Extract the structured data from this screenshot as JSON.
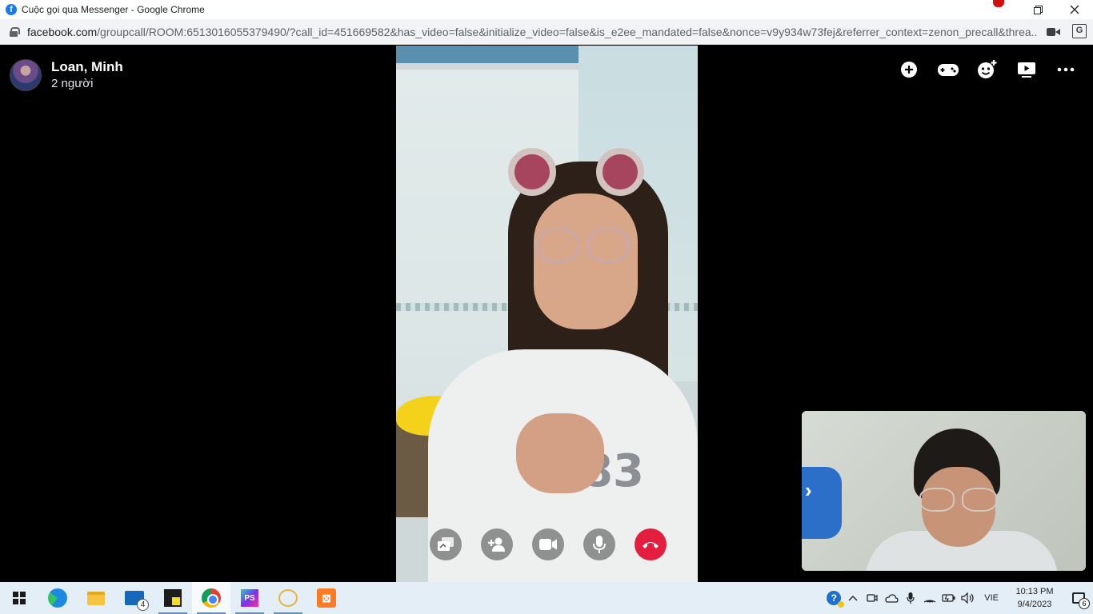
{
  "window": {
    "title": "Cuộc gọi qua Messenger - Google Chrome",
    "favicon": "facebook-icon",
    "controls": [
      "minimize-icon",
      "restore-icon",
      "close-icon"
    ]
  },
  "addressbar": {
    "host": "facebook.com",
    "path": "/groupcall/ROOM:6513016055379490/?call_id=451669582&has_video=false&initialize_video=false&is_e2ee_mandated=false&nonce=v9y934w73fej&referrer_context=zenon_precall&threa...",
    "icons": [
      "camera-icon",
      "translate-icon"
    ]
  },
  "call": {
    "name": "Loan, Minh",
    "participants": "2 người",
    "top_actions": [
      "add-icon",
      "game-icon",
      "effects-icon",
      "watch-together-icon",
      "more-icon"
    ],
    "controls": [
      "share-screen-icon",
      "add-person-icon",
      "video-icon",
      "microphone-icon",
      "end-call-icon"
    ],
    "remote_shirt_text": "83",
    "end_color": "#e41e3f"
  },
  "taskbar": {
    "apps": [
      "windows-start-icon",
      "edge-icon",
      "file-explorer-icon",
      "mail-icon",
      "sticky-notes-icon",
      "chrome-icon",
      "phpstorm-icon",
      "cloud-app-icon",
      "xampp-icon"
    ],
    "mail_badge": "4",
    "phpstorm_label": "PS",
    "language": "VIE",
    "time": "10:13 PM",
    "date": "9/4/2023",
    "notification_count": "6"
  }
}
